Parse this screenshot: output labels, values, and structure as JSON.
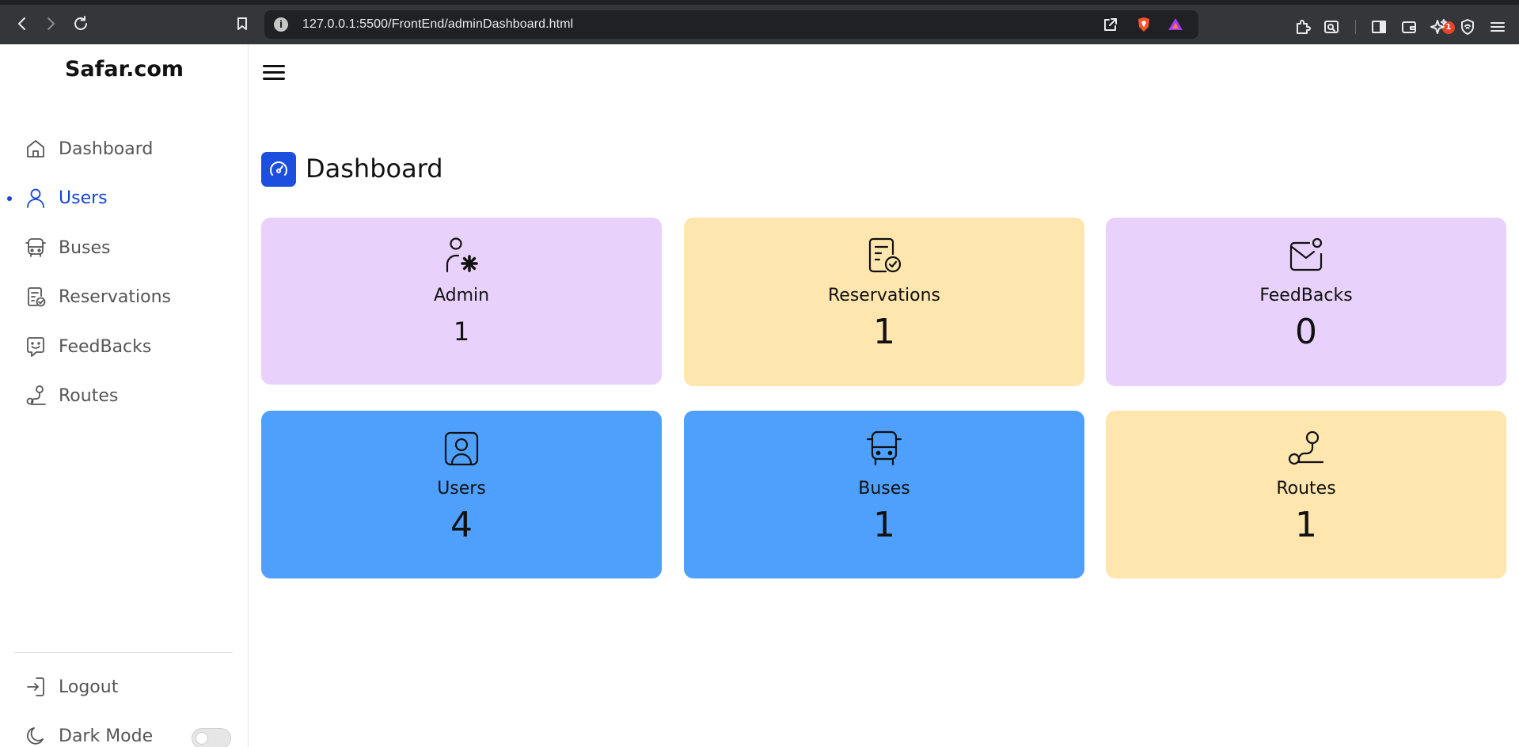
{
  "browser": {
    "url": "127.0.0.1:5500/FrontEnd/adminDashboard.html",
    "info_glyph": "i",
    "notification_count": "1"
  },
  "sidebar": {
    "brand": "Safar.com",
    "items": [
      {
        "label": "Dashboard",
        "icon": "home-icon"
      },
      {
        "label": "Users",
        "icon": "user-icon"
      },
      {
        "label": "Buses",
        "icon": "bus-icon"
      },
      {
        "label": "Reservations",
        "icon": "reservations-icon"
      },
      {
        "label": "FeedBacks",
        "icon": "feedback-icon"
      },
      {
        "label": "Routes",
        "icon": "route-icon"
      }
    ],
    "active_item": "Users",
    "logout": "Logout",
    "dark_mode": "Dark Mode",
    "dark_mode_enabled": false
  },
  "main": {
    "title": "Dashboard",
    "cards": [
      {
        "label": "Admin",
        "value": "1",
        "icon": "admin-settings-icon",
        "color": "#e8d1fb"
      },
      {
        "label": "Reservations",
        "value": "1",
        "icon": "reservations-icon",
        "color": "#fee6ae"
      },
      {
        "label": "FeedBacks",
        "value": "0",
        "icon": "mail-notification-icon",
        "color": "#e8d1fb"
      },
      {
        "label": "Users",
        "value": "4",
        "icon": "user-profile-icon",
        "color": "#4ea0fc"
      },
      {
        "label": "Buses",
        "value": "1",
        "icon": "bus-icon",
        "color": "#4ea0fc"
      },
      {
        "label": "Routes",
        "value": "1",
        "icon": "route-icon",
        "color": "#fee6ae"
      }
    ]
  },
  "colors": {
    "accent": "#1546d6",
    "title_icon_bg": "#1c4ee0",
    "purple_card": "#e8d1fb",
    "yellow_card": "#fee6ae",
    "blue_card": "#4ea0fc"
  }
}
